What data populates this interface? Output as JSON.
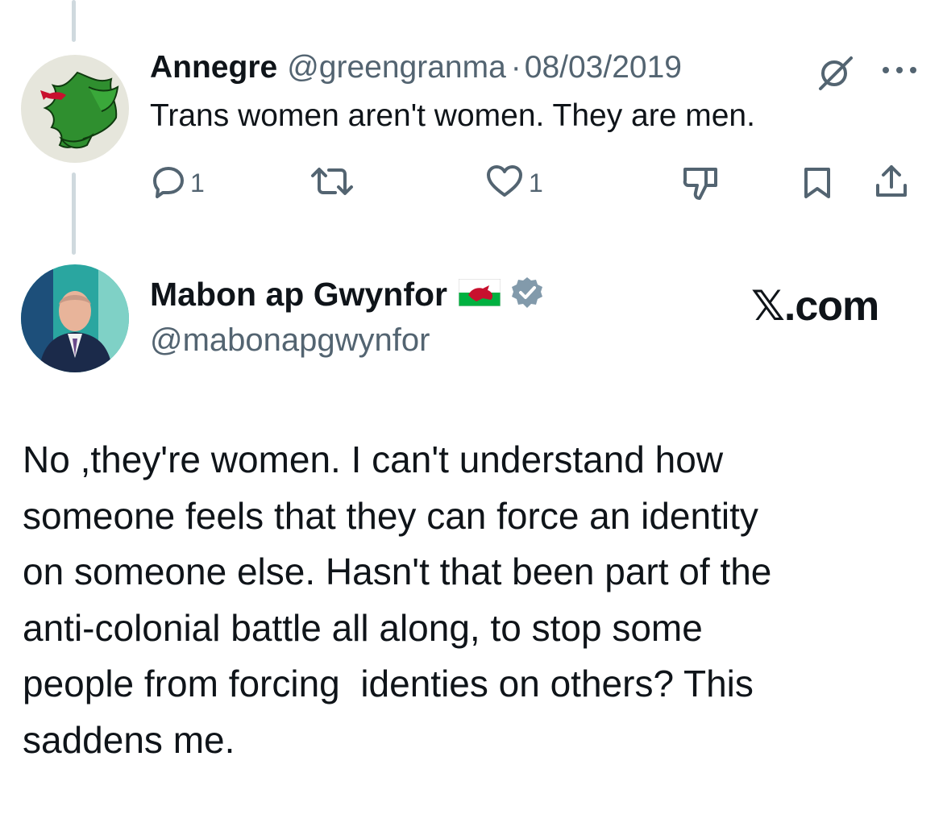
{
  "tweet1": {
    "name": "Annegre",
    "handle": "@greengranma",
    "separator": "·",
    "date": "08/03/2019",
    "text": "Trans women aren't women. They are men.",
    "avatar_icon": "welsh-dragon-avatar",
    "actions": {
      "reply_count": "1",
      "repost_count": "",
      "like_count": "1"
    }
  },
  "tweet2": {
    "name": "Mabon ap Gwynfor",
    "flag_icon": "wales-flag-icon",
    "verified_icon": "verified-badge-icon",
    "handle": "@mabonapgwynfor",
    "watermark": "𝕏.com",
    "body_lines": [
      "No ,they're women. I can't understand how",
      "someone feels that they can force an identity",
      "on someone else. Hasn't that been part of the",
      "anti-colonial battle all along, to stop some",
      "people from forcing  identies on others? This",
      "saddens me."
    ]
  },
  "colors": {
    "text": "#0f1419",
    "secondary": "#536471",
    "thread_line": "#cfd9de",
    "verified": "#829aab",
    "dragon_green": "#2f8f2f",
    "dragon_red": "#c8102e"
  }
}
